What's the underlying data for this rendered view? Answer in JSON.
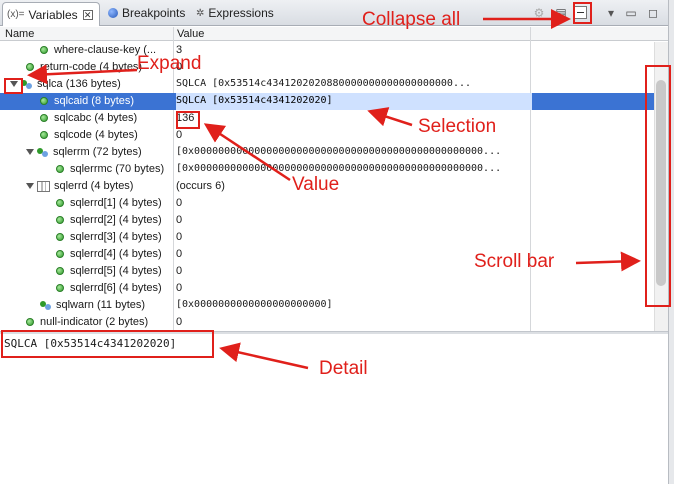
{
  "tabs": [
    {
      "label": "Variables",
      "prefix": "(x)="
    },
    {
      "label": "Breakpoints"
    },
    {
      "label": "Expressions"
    }
  ],
  "columns": {
    "name": "Name",
    "value": "Value"
  },
  "rows": [
    {
      "name": "where-clause-key (...",
      "value": "3"
    },
    {
      "name": "return-code (4 bytes)",
      "value": "0"
    },
    {
      "name": "sqlca (136 bytes)",
      "value": "SQLCA    [0x53514c4341202020880000000000000000000..."
    },
    {
      "name": "sqlcaid (8 bytes)",
      "value": "SQLCA    [0x53514c4341202020]"
    },
    {
      "name": "sqlcabc (4 bytes)",
      "value": "136"
    },
    {
      "name": "sqlcode (4 bytes)",
      "value": "0"
    },
    {
      "name": "sqlerrm (72 bytes)",
      "value": "[0x000000000000000000000000000000000000000000000000..."
    },
    {
      "name": "sqlerrmc (70 bytes)",
      "value": "[0x000000000000000000000000000000000000000000000000..."
    },
    {
      "name": "sqlerrd (4 bytes)",
      "value": "(occurs 6)"
    },
    {
      "name": "sqlerrd[1] (4 bytes)",
      "value": "0"
    },
    {
      "name": "sqlerrd[2] (4 bytes)",
      "value": "0"
    },
    {
      "name": "sqlerrd[3] (4 bytes)",
      "value": "0"
    },
    {
      "name": "sqlerrd[4] (4 bytes)",
      "value": "0"
    },
    {
      "name": "sqlerrd[5] (4 bytes)",
      "value": "0"
    },
    {
      "name": "sqlerrd[6] (4 bytes)",
      "value": "0"
    },
    {
      "name": "sqlwarn (11 bytes)",
      "value": "[0x0000000000000000000000]"
    },
    {
      "name": "null-indicator (2 bytes)",
      "value": "0"
    }
  ],
  "detail": "SQLCA    [0x53514c4341202020]",
  "annotations": {
    "collapse_all": "Collapse all",
    "expand": "Expand",
    "selection": "Selection",
    "value": "Value",
    "scroll_bar": "Scroll bar",
    "detail": "Detail"
  },
  "colors": {
    "annotation": "#e0201b",
    "selection": "#3b73d3"
  }
}
